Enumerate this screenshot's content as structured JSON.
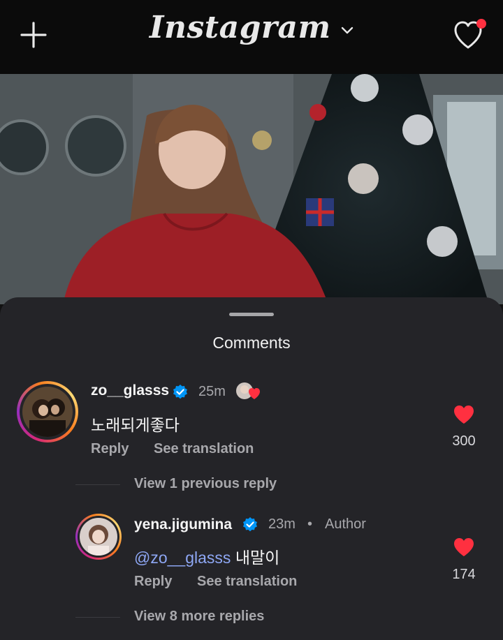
{
  "header": {
    "logo": "Instagram",
    "plus_icon": "plus-icon",
    "dropdown_icon": "chevron-down-icon",
    "activity_icon": "heart-outline-icon",
    "notification_dot_color": "#ff3040"
  },
  "sheet": {
    "title": "Comments"
  },
  "comments": [
    {
      "username": "zo__glasss",
      "verified": true,
      "time": "25m",
      "text": "노래되게좋다",
      "reply_label": "Reply",
      "translate_label": "See translation",
      "likes": "300"
    }
  ],
  "thread": {
    "view_previous": "View 1 previous reply",
    "reply": {
      "username": "yena.jigumina",
      "verified": true,
      "time": "23m",
      "separator": "•",
      "role": "Author",
      "mention": "@zo__glasss",
      "text": "내말이",
      "reply_label": "Reply",
      "translate_label": "See translation",
      "likes": "174"
    },
    "view_more": "View 8 more replies"
  },
  "colors": {
    "like_red": "#ff3040",
    "verified_blue": "#0095f6",
    "mention_blue": "#8ea7f4"
  }
}
